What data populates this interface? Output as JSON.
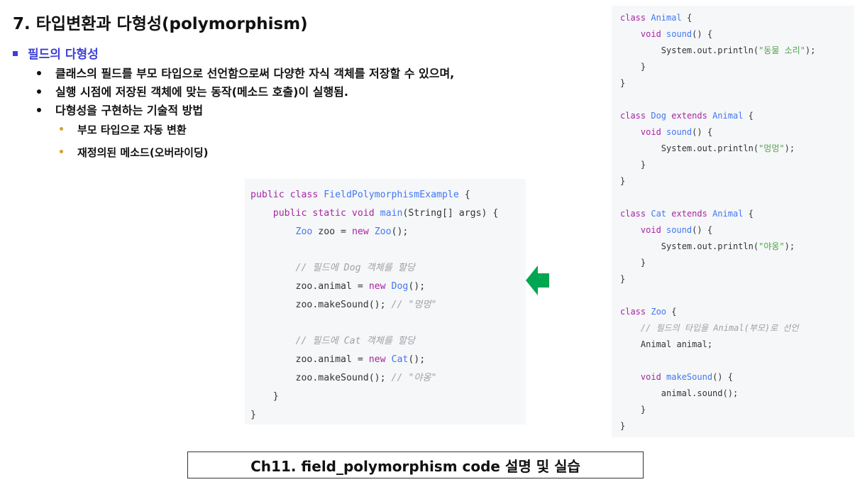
{
  "slide": {
    "title": "7. 타입변환과 다형성(polymorphism)",
    "section": "필드의 다형성",
    "bullets": [
      "클래스의 필드를 부모 타입으로 선언함으로써 다양한 자식 객체를 저장할 수 있으며,",
      "실행 시점에 저장된 객체에 맞는 동작(메소드 호출)이 실행됨.",
      "다형성을 구현하는 기술적 방법"
    ],
    "subbullets": [
      "부모 타입으로 자동 변환",
      "재정의된 메소드(오버라이딩)"
    ],
    "caption": "Ch11. field_polymorphism code 설명 및 실습"
  },
  "colors": {
    "accent": "#3d3fd6",
    "subbullet": "#d4a02a",
    "arrow": "#00a651",
    "keyword": "#a626a4",
    "type": "#4078f2",
    "string": "#50a14f",
    "comment": "#a0a1a7",
    "code_bg": "#f6f7f8"
  },
  "icons": {
    "arrow": "left-arrow-icon"
  },
  "code_main": [
    [
      [
        "kw",
        "public class "
      ],
      [
        "ty",
        "FieldPolymorphismExample"
      ],
      [
        "p",
        " {"
      ]
    ],
    [
      [
        "p",
        "    "
      ],
      [
        "kw",
        "public static void "
      ],
      [
        "fn",
        "main"
      ],
      [
        "p",
        "(String[] args) {"
      ]
    ],
    [
      [
        "p",
        "        "
      ],
      [
        "ty",
        "Zoo"
      ],
      [
        "p",
        " zoo = "
      ],
      [
        "kw",
        "new "
      ],
      [
        "ty",
        "Zoo"
      ],
      [
        "p",
        "();"
      ]
    ],
    [],
    [
      [
        "p",
        "        "
      ],
      [
        "cm",
        "// 필드에 Dog 객체를 할당"
      ]
    ],
    [
      [
        "p",
        "        zoo.animal = "
      ],
      [
        "kw",
        "new "
      ],
      [
        "ty",
        "Dog"
      ],
      [
        "p",
        "();"
      ]
    ],
    [
      [
        "p",
        "        zoo.makeSound(); "
      ],
      [
        "cm",
        "// \"멍멍\""
      ]
    ],
    [],
    [
      [
        "p",
        "        "
      ],
      [
        "cm",
        "// 필드에 Cat 객체를 할당"
      ]
    ],
    [
      [
        "p",
        "        zoo.animal = "
      ],
      [
        "kw",
        "new "
      ],
      [
        "ty",
        "Cat"
      ],
      [
        "p",
        "();"
      ]
    ],
    [
      [
        "p",
        "        zoo.makeSound(); "
      ],
      [
        "cm",
        "// \"야옹\""
      ]
    ],
    [
      [
        "p",
        "    }"
      ]
    ],
    [
      [
        "p",
        "}"
      ]
    ]
  ],
  "code_right": [
    [
      [
        "kw",
        "class "
      ],
      [
        "ty",
        "Animal"
      ],
      [
        "p",
        " {"
      ]
    ],
    [
      [
        "p",
        "    "
      ],
      [
        "kw",
        "void "
      ],
      [
        "fn",
        "sound"
      ],
      [
        "p",
        "() {"
      ]
    ],
    [
      [
        "p",
        "        System.out.println("
      ],
      [
        "str",
        "\"동물 소리\""
      ],
      [
        "p",
        ");"
      ]
    ],
    [
      [
        "p",
        "    }"
      ]
    ],
    [
      [
        "p",
        "}"
      ]
    ],
    [],
    [
      [
        "kw",
        "class "
      ],
      [
        "ty",
        "Dog"
      ],
      [
        "kw",
        " extends "
      ],
      [
        "ty",
        "Animal"
      ],
      [
        "p",
        " {"
      ]
    ],
    [
      [
        "p",
        "    "
      ],
      [
        "kw",
        "void "
      ],
      [
        "fn",
        "sound"
      ],
      [
        "p",
        "() {"
      ]
    ],
    [
      [
        "p",
        "        System.out.println("
      ],
      [
        "str",
        "\"멍멍\""
      ],
      [
        "p",
        ");"
      ]
    ],
    [
      [
        "p",
        "    }"
      ]
    ],
    [
      [
        "p",
        "}"
      ]
    ],
    [],
    [
      [
        "kw",
        "class "
      ],
      [
        "ty",
        "Cat"
      ],
      [
        "kw",
        " extends "
      ],
      [
        "ty",
        "Animal"
      ],
      [
        "p",
        " {"
      ]
    ],
    [
      [
        "p",
        "    "
      ],
      [
        "kw",
        "void "
      ],
      [
        "fn",
        "sound"
      ],
      [
        "p",
        "() {"
      ]
    ],
    [
      [
        "p",
        "        System.out.println("
      ],
      [
        "str",
        "\"야옹\""
      ],
      [
        "p",
        ");"
      ]
    ],
    [
      [
        "p",
        "    }"
      ]
    ],
    [
      [
        "p",
        "}"
      ]
    ],
    [],
    [
      [
        "kw",
        "class "
      ],
      [
        "ty",
        "Zoo"
      ],
      [
        "p",
        " {"
      ]
    ],
    [
      [
        "p",
        "    "
      ],
      [
        "cm",
        "// 필드의 타입을 Animal(부모)로 선언"
      ]
    ],
    [
      [
        "p",
        "    Animal animal;"
      ]
    ],
    [],
    [
      [
        "p",
        "    "
      ],
      [
        "kw",
        "void "
      ],
      [
        "fn",
        "makeSound"
      ],
      [
        "p",
        "() {"
      ]
    ],
    [
      [
        "p",
        "        animal.sound();"
      ]
    ],
    [
      [
        "p",
        "    }"
      ]
    ],
    [
      [
        "p",
        "}"
      ]
    ]
  ]
}
